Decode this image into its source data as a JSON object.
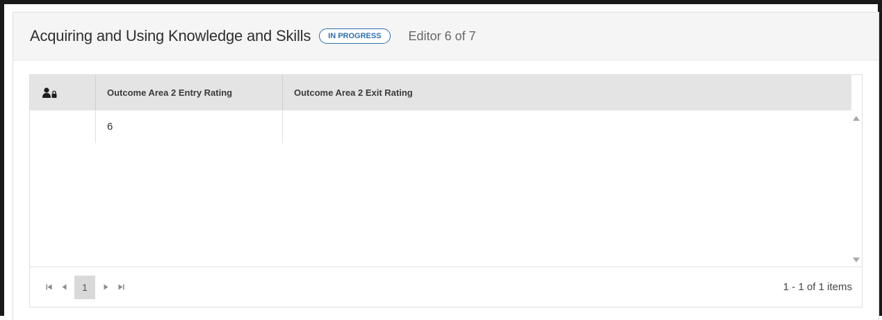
{
  "header": {
    "title": "Acquiring and Using Knowledge and Skills",
    "status_badge": "IN PROGRESS",
    "editor_count": "Editor 6 of 7"
  },
  "grid": {
    "columns": [
      {
        "label": "",
        "icon": "user-lock-icon"
      },
      {
        "label": "Outcome Area 2 Entry Rating"
      },
      {
        "label": "Outcome Area 2 Exit Rating"
      }
    ],
    "rows": [
      {
        "entry_rating": "6",
        "exit_rating": ""
      }
    ]
  },
  "pager": {
    "current_page": "1",
    "info": "1 - 1 of 1 items"
  },
  "colors": {
    "accent": "#2d6fb0",
    "header_bg": "#f5f5f5",
    "grid_header_bg": "#e4e4e4"
  }
}
